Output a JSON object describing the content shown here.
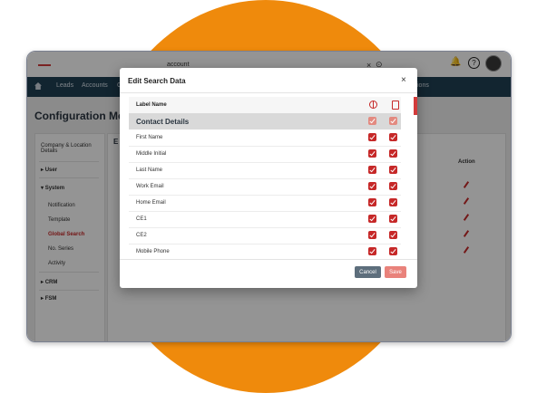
{
  "colors": {
    "accent_circle": "#ef8a0c",
    "navbar": "#1f4054",
    "checkbox": "#c62828",
    "cancel": "#5d6e7c",
    "save": "#e9827b"
  },
  "topbar": {
    "search_value": "account",
    "clear_icon": "close-icon",
    "search_icon": "search-icon",
    "bell_icon": "bell-icon",
    "help_icon": "help-icon",
    "help_glyph": "?"
  },
  "nav": {
    "items": [
      "Leads",
      "Accounts",
      "C"
    ],
    "trailing": "ions"
  },
  "page": {
    "title": "Configuration Menu",
    "panel_heading": "E",
    "action_header": "Action"
  },
  "sidebar": {
    "company": "Company & Location Details",
    "user": "User",
    "system": "System",
    "sub_items": [
      "Notification",
      "Template",
      "Global Search",
      "No. Series",
      "Activity"
    ],
    "crm": "CRM",
    "fsm": "FSM"
  },
  "modal": {
    "title": "Edit Search Data",
    "close_glyph": "×",
    "column_label": "Label Name",
    "section": "Contact Details",
    "rows": [
      "First Name",
      "Middle Initial",
      "Last Name",
      "Work Email",
      "Home Email",
      "CE1",
      "CE2",
      "Mobile Phone"
    ],
    "cancel_label": "Cancel",
    "save_label": "Save"
  }
}
